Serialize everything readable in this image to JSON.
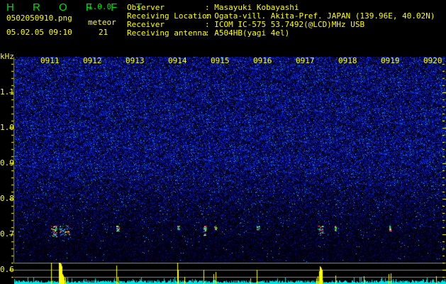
{
  "app": {
    "name": "H R O F F T",
    "version": "1.0.0"
  },
  "file": {
    "filename": "0502050910.png",
    "datetime": "05.02.05 09:10"
  },
  "meteor": {
    "label": "meteor",
    "count": "21"
  },
  "info": [
    {
      "label": "Observer",
      "value": ": Masayuki Kobayashi"
    },
    {
      "label": "Receiving Location",
      "value": ": Ogata-vill. Akita-Pref. JAPAN (139.96E, 40.02N)"
    },
    {
      "label": "Receiver",
      "value": ": ICOM IC-575 53.7492(@LCD)MHz USB"
    },
    {
      "label": "Receiving antenna",
      "value": ": A504HB(yagi 4el)"
    }
  ],
  "axis": {
    "unit": "kHz",
    "y_labels": [
      "1.1",
      "1.0",
      "0.9",
      "0.8",
      "0.7",
      "0.6"
    ],
    "time_labels": [
      "0911",
      "0912",
      "0913",
      "0914",
      "0915",
      "0916",
      "0917",
      "0918",
      "0919",
      "0920"
    ]
  },
  "colors": {
    "text": "#ffff00",
    "title": "#00e000",
    "noise": "#1020c0",
    "signal_bar": "#ffff00",
    "noise_bar": "#00e0e0"
  }
}
